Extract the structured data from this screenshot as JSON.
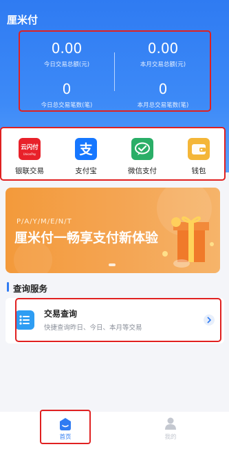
{
  "app": {
    "title": "厘米付"
  },
  "stats": {
    "today_amount": {
      "value": "0.00",
      "label": "今日交易总额(元)"
    },
    "month_amount": {
      "value": "0.00",
      "label": "本月交易总额(元)"
    },
    "today_count": {
      "value": "0",
      "label": "今日总交易笔数(笔)"
    },
    "month_count": {
      "value": "0",
      "label": "本月总交易笔数(笔)"
    }
  },
  "quick_actions": [
    {
      "label": "银联交易",
      "icon": "unionpay-cloud-pay-icon",
      "icon_text": "云闪付",
      "icon_subtext": "UnionPay"
    },
    {
      "label": "支付宝",
      "icon": "alipay-icon",
      "icon_text": "支"
    },
    {
      "label": "微信支付",
      "icon": "wechat-pay-icon"
    },
    {
      "label": "钱包",
      "icon": "wallet-icon"
    }
  ],
  "banner": {
    "subtitle": "P/A/Y/M/E/N/T",
    "title": "厘米付一畅享支付新体验"
  },
  "section": {
    "title": "查询服务"
  },
  "service_card": {
    "title": "交易查询",
    "description": "快捷查询昨日、今日、本月等交易",
    "icon": "list-icon"
  },
  "tabbar": {
    "home_label": "首页",
    "mine_label": "我的",
    "active_color": "#2f7bf2",
    "inactive_color": "#c4c8d0"
  },
  "colors": {
    "primary": "#2f7bf2",
    "highlight_outline": "#e02020",
    "banner_orange": "#f4a553"
  }
}
